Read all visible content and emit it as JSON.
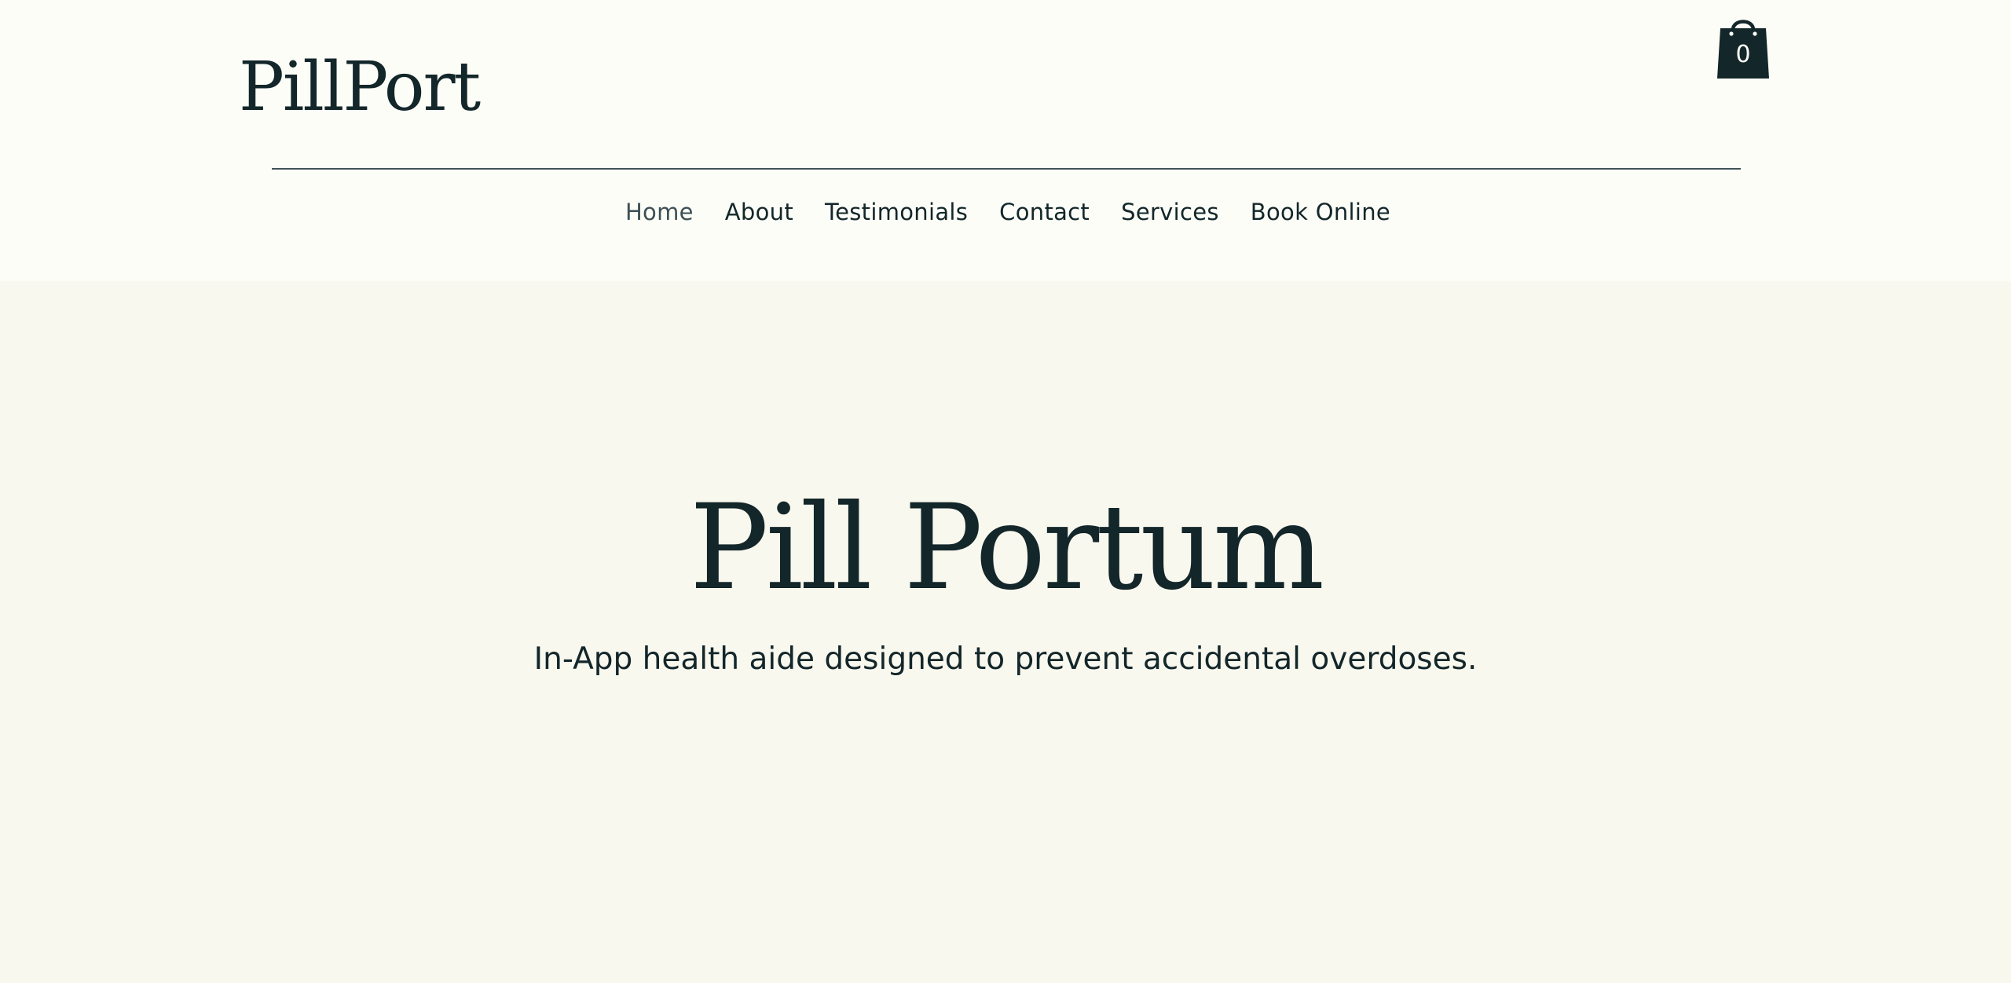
{
  "header": {
    "logo": "PillPort",
    "cart": {
      "count": "0",
      "icon": "shopping-bag-icon"
    },
    "nav": [
      {
        "label": "Home",
        "active": true
      },
      {
        "label": "About",
        "active": false
      },
      {
        "label": "Testimonials",
        "active": false
      },
      {
        "label": "Contact",
        "active": false
      },
      {
        "label": "Services",
        "active": false
      },
      {
        "label": "Book Online",
        "active": false
      }
    ]
  },
  "hero": {
    "title": "Pill Portum",
    "subtitle": "In-App health aide designed to prevent accidental overdoses."
  },
  "colors": {
    "text": "#13262A",
    "header_bg": "#FDFDF7",
    "hero_bg": "#F9F8EE",
    "divider": "#415257"
  }
}
